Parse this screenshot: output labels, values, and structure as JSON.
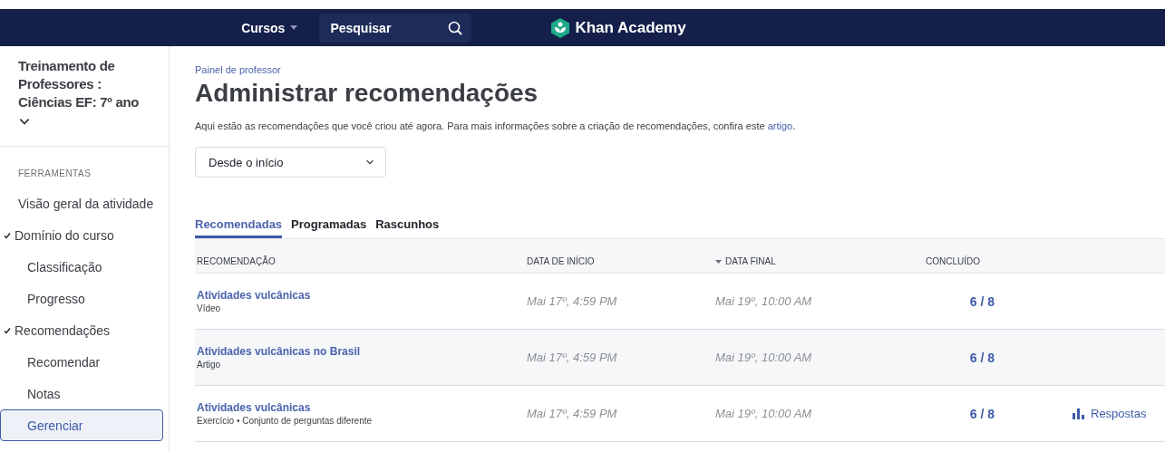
{
  "nav": {
    "courses_label": "Cursos",
    "search": {
      "placeholder": "Pesquisar"
    },
    "logo_text": "Khan Academy"
  },
  "sidebar": {
    "class_title": "Treinamento de Professores : Ciências EF: 7º ano",
    "section_label": "FERRAMENTAS",
    "items": [
      {
        "label": "Visão geral da atividade",
        "selected": false
      },
      {
        "label": "Domínio do curso",
        "selected": false,
        "expanded": true,
        "children": [
          {
            "label": "Classificação",
            "selected": false
          },
          {
            "label": "Progresso",
            "selected": false
          }
        ]
      },
      {
        "label": "Recomendações",
        "selected": false,
        "expanded": true,
        "children": [
          {
            "label": "Recomendar",
            "selected": false
          },
          {
            "label": "Notas",
            "selected": false
          },
          {
            "label": "Gerenciar",
            "selected": true
          }
        ]
      }
    ]
  },
  "main": {
    "breadcrumb": "Painel de professor",
    "title": "Administrar recomendações",
    "intro": "Aqui estão as recomendações que você criou até agora. Para mais informações sobre a criação de recomendações, confira este",
    "intro_link": "artigo",
    "intro_end": ".",
    "period_select": {
      "value": "Desde o início"
    },
    "tabs": [
      {
        "label": "Recomendadas",
        "selected": true
      },
      {
        "label": "Programadas",
        "selected": false
      },
      {
        "label": "Rascunhos",
        "selected": false
      }
    ],
    "table": {
      "columns": [
        {
          "label": "RECOMENDAÇÃO",
          "sorted": false
        },
        {
          "label": "DATA DE INÍCIO",
          "sorted": false
        },
        {
          "label": "DATA FINAL",
          "sorted": true
        },
        {
          "label": "CONCLUÍDO",
          "sorted": false
        }
      ],
      "rows": [
        {
          "title": "Atividades vulcânicas",
          "subtitle": "Vídeo",
          "start": "Mai 17º, 4:59 PM",
          "end": "Mai 19º, 10:00 AM",
          "completed": "6 / 8"
        },
        {
          "title": "Atividades vulcânicas no Brasil",
          "subtitle": "Artigo",
          "start": "Mai 17º, 4:59 PM",
          "end": "Mai 19º, 10:00 AM",
          "completed": "6 / 8"
        },
        {
          "title": "Atividades vulcânicas",
          "subtitle": "Exercício • Conjunto de perguntas diferente",
          "start": "Mai 17º, 4:59 PM",
          "end": "Mai 19º, 10:00 AM",
          "completed": "6 / 8",
          "action": "Respostas"
        }
      ]
    }
  }
}
